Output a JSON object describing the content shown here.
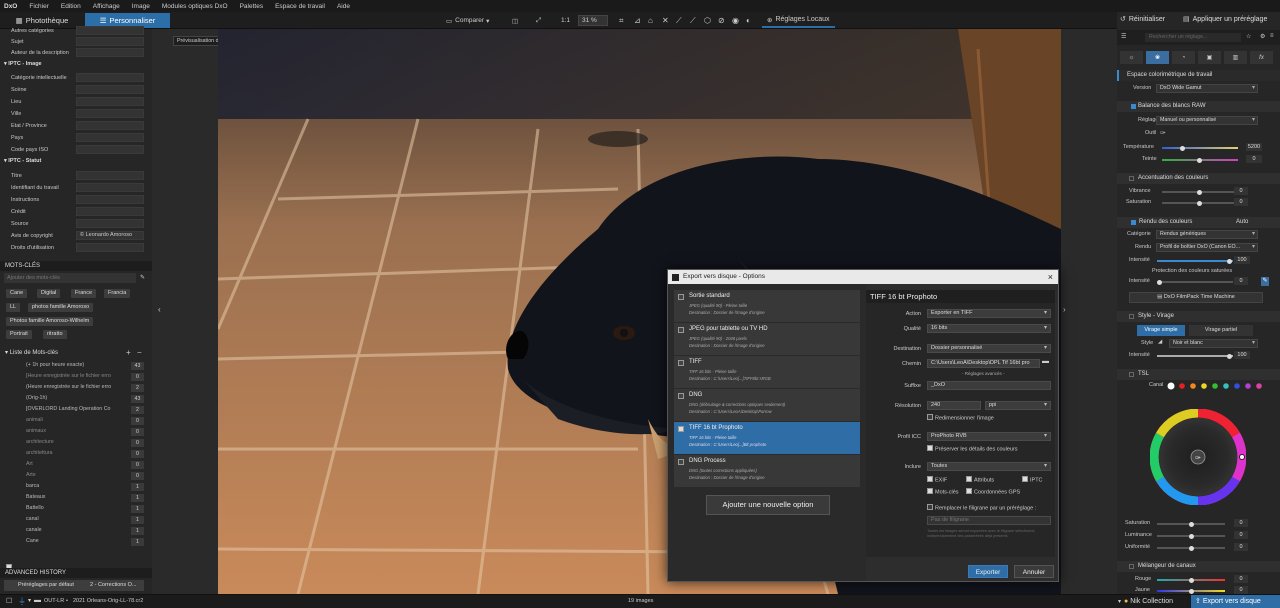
{
  "menubar": {
    "logo": "DxO",
    "items": [
      "Fichier",
      "Edition",
      "Affichage",
      "Image",
      "Modules optiques DxO",
      "Palettes",
      "Espace de travail",
      "Aide"
    ]
  },
  "toolbar": {
    "tab_library": "Photothèque",
    "tab_customize": "Personnaliser",
    "compare": "Comparer",
    "zoom_1to1": "1:1",
    "zoom_value": "31 %",
    "local_adjust": "Réglages Locaux",
    "reset": "Réinitialiser",
    "apply_preset": "Appliquer un préréglage"
  },
  "tooltip": "Prévisualisation des corrections",
  "iptc": {
    "top_rows": [
      {
        "label": "Autres catégories"
      },
      {
        "label": "Sujet"
      },
      {
        "label": "Auteur de la description"
      }
    ],
    "image_header": "IPTC - Image",
    "image_rows": [
      {
        "label": "Catégorie intellectuelle"
      },
      {
        "label": "Scène"
      },
      {
        "label": "Lieu"
      },
      {
        "label": "Ville"
      },
      {
        "label": "Etat / Province"
      },
      {
        "label": "Pays"
      },
      {
        "label": "Code pays ISO"
      }
    ],
    "status_header": "IPTC - Statut",
    "status_rows": [
      {
        "label": "Titre",
        "value": ""
      },
      {
        "label": "Identifiant du travail",
        "value": ""
      },
      {
        "label": "Instructions",
        "value": ""
      },
      {
        "label": "Crédit",
        "value": ""
      },
      {
        "label": "Source",
        "value": ""
      },
      {
        "label": "Avis de copyright",
        "value": "© Leonardo Amoroso"
      },
      {
        "label": "Droits d'utilisation",
        "value": ""
      }
    ]
  },
  "keywords": {
    "header": "MOTS-CLÉS",
    "placeholder": "Ajouter des mots-clés",
    "tags": [
      "Cane",
      "Digital",
      "France",
      "Francia",
      "LL",
      "photos famille Amoroso",
      "Photos famille Amoroso-Wilhelm",
      "Portrait",
      "ritratto"
    ],
    "list_header": "Liste de Mots-clés",
    "list": [
      {
        "name": "(+ 1h pour heure exacte)",
        "count": "43"
      },
      {
        "name": "[Heure enregistrée sur le fichier erro",
        "count": "0"
      },
      {
        "name": "(Heure enregistrée sur le fichier erro",
        "count": "2"
      },
      {
        "name": "(Orig-1h)",
        "count": "43"
      },
      {
        "name": "[OVERLORD Landing Operation Co",
        "count": "2"
      },
      {
        "name": "animali",
        "count": "0"
      },
      {
        "name": "animaux",
        "count": "0"
      },
      {
        "name": "architecture",
        "count": "0"
      },
      {
        "name": "architettura",
        "count": "0"
      },
      {
        "name": "Art",
        "count": "0"
      },
      {
        "name": "Arte",
        "count": "0"
      },
      {
        "name": "barca",
        "count": "1"
      },
      {
        "name": "Bateaux",
        "count": "1"
      },
      {
        "name": "Battello",
        "count": "1"
      },
      {
        "name": "canal",
        "count": "1"
      },
      {
        "name": "canale",
        "count": "1"
      },
      {
        "name": "Cane",
        "count": "1"
      }
    ]
  },
  "history": {
    "header": "ADVANCED HISTORY",
    "col1": "Préréglages par défaut",
    "col2": "2 - Corrections O..."
  },
  "dialog": {
    "title": "Export vers disque - Options",
    "options": [
      {
        "title": "Sortie standard",
        "line1": "JPEG (qualité 90) - Pleine taille",
        "line2": "Destination : Dossier de l'image d'origine"
      },
      {
        "title": "JPEG pour tablette ou TV HD",
        "line1": "JPEG (qualité 90) - 2048 pixels",
        "line2": "Destination : Dossier de l'image d'origine"
      },
      {
        "title": "TIFF",
        "line1": "TIFF 16 bits - Pleine taille",
        "line2": "Destination : C:\\Users\\Leo[...]TIFF8bt sRGB"
      },
      {
        "title": "DNG",
        "line1": "DNG (débruitage & corrections optiques seulement)",
        "line2": "Destination : C:\\Users\\LeoA\\Desktop\\Parrow"
      },
      {
        "title": "TIFF 16 bt Prophoto",
        "line1": "TIFF 16 bits - Pleine taille",
        "line2": "Destination : C:\\Users\\Leo[...]Bit prophoto"
      },
      {
        "title": "DNG Process",
        "line1": "DNG (toutes corrections appliquées)",
        "line2": "Destination : Dossier de l'image d'origine"
      }
    ],
    "add_option": "Ajouter une nouvelle option",
    "form_title": "TIFF 16 bt Prophoto",
    "action_label": "Action",
    "action_value": "Exporter en TIFF",
    "quality_label": "Qualité",
    "quality_value": "16 bits",
    "dest_label": "Destination",
    "dest_value": "Dossier personnalisé",
    "path_label": "Chemin",
    "path_value": "C:\\Users\\LeoA\\Desktop\\DPL Tif 16bt pro",
    "advanced_settings": "- Réglages avancés -",
    "suffix_label": "Suffixe",
    "suffix_value": "_DxO",
    "res_label": "Résolution",
    "res_value": "240",
    "res_unit": "ppi",
    "resize": "Redimensionner l'image",
    "icc_label": "Profil ICC",
    "icc_value": "ProPhoto RVB",
    "preserve_colors": "Préserver les détails des couleurs",
    "include_label": "Inclure",
    "include_value": "Toutes",
    "exif": "EXIF",
    "attributes": "Attributs",
    "iptc": "IPTC",
    "keywords": "Mots-clés",
    "gps": "Coordonnées GPS",
    "watermark": "Remplacer le filigrane par un préréglage :",
    "no_watermark": "Pas de filigrane",
    "watermark_note": "Toutes les images seront exportées avec le filigrane sélectionné, indépendamment des paramètres déjà présents",
    "export_btn": "Exporter",
    "cancel_btn": "Annuler"
  },
  "right": {
    "search_placeholder": "Rechercher un réglage...",
    "color_space": "Espace colorimétrique de travail",
    "version_label": "Version",
    "version_value": "DxO Wide Gamut",
    "wb_header": "Balance des blancs RAW",
    "wb_setting_label": "Réglage",
    "wb_setting_value": "Manuel ou personnalisé",
    "tool_label": "Outil",
    "temp_label": "Température",
    "temp_value": "5200",
    "tint_label": "Teinte",
    "tint_value": "0",
    "accent_header": "Accentuation des couleurs",
    "vibrance_label": "Vibrance",
    "vibrance_value": "0",
    "saturation_label": "Saturation",
    "saturation_value": "0",
    "render_header": "Rendu des couleurs",
    "render_auto": "Auto",
    "category_label": "Catégorie",
    "category_value": "Rendus génériques",
    "render_label": "Rendu",
    "render_value": "Profil de boîtier DxO (Canon EO...",
    "intensity_label": "Intensité",
    "intensity_value": "100",
    "protect_label": "Protection des couleurs saturées",
    "intensity2_label": "Intensité",
    "intensity2_value": "0",
    "filmpack": "DxO FilmPack Time Machine",
    "style_header": "Style - Virage",
    "virage_simple": "Virage simple",
    "virage_partiel": "Virage partiel",
    "style_label": "Style",
    "style_value": "Noir et blanc",
    "intensity3_label": "Intensité",
    "intensity3_value": "100",
    "hsl_header": "TSL",
    "channel_label": "Canal",
    "hsl_saturation": "Saturation",
    "hsl_saturation_value": "0",
    "luminance": "Luminance",
    "luminance_value": "0",
    "uniformity": "Uniformité",
    "uniformity_value": "0",
    "mixer_header": "Mélangeur de canaux",
    "red_label": "Rouge",
    "red_value": "0",
    "yellow_label": "Jaune",
    "yellow_value": "0"
  },
  "status": {
    "folder": "OUT-LR",
    "file": "2021 Orleans-Orig-LL-78.cr2",
    "count": "19 images",
    "nik": "Nik Collection",
    "export": "Export vers disque"
  }
}
